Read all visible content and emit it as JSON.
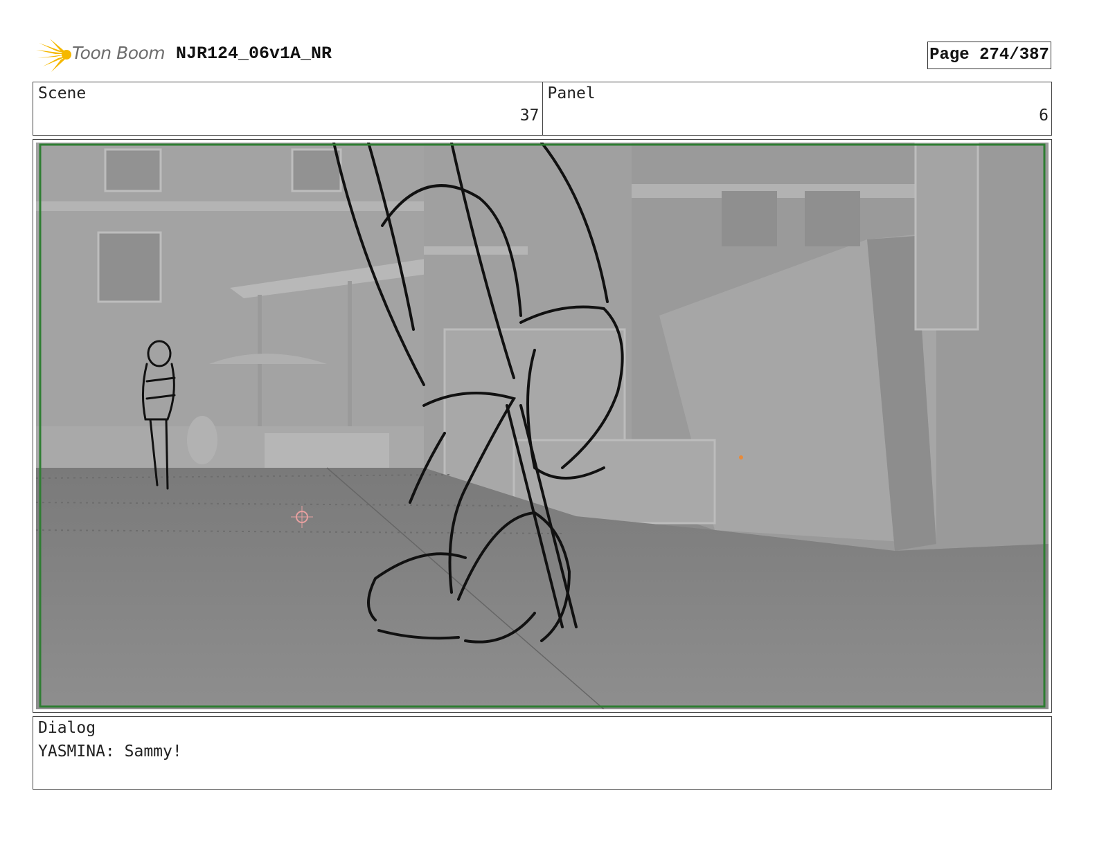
{
  "header": {
    "logo_text": "Toon Boom",
    "title": "NJR124_06v1A_NR",
    "page": "Page 274/387"
  },
  "scene": {
    "label": "Scene",
    "value": "37"
  },
  "panel": {
    "label": "Panel",
    "value": "6"
  },
  "dialog": {
    "label": "Dialog",
    "text": "YASMINA: Sammy!"
  },
  "colors": {
    "frame_border": "#2e7d32",
    "logo_accent": "#f5b800",
    "logo_text": "#6d6d6d"
  }
}
